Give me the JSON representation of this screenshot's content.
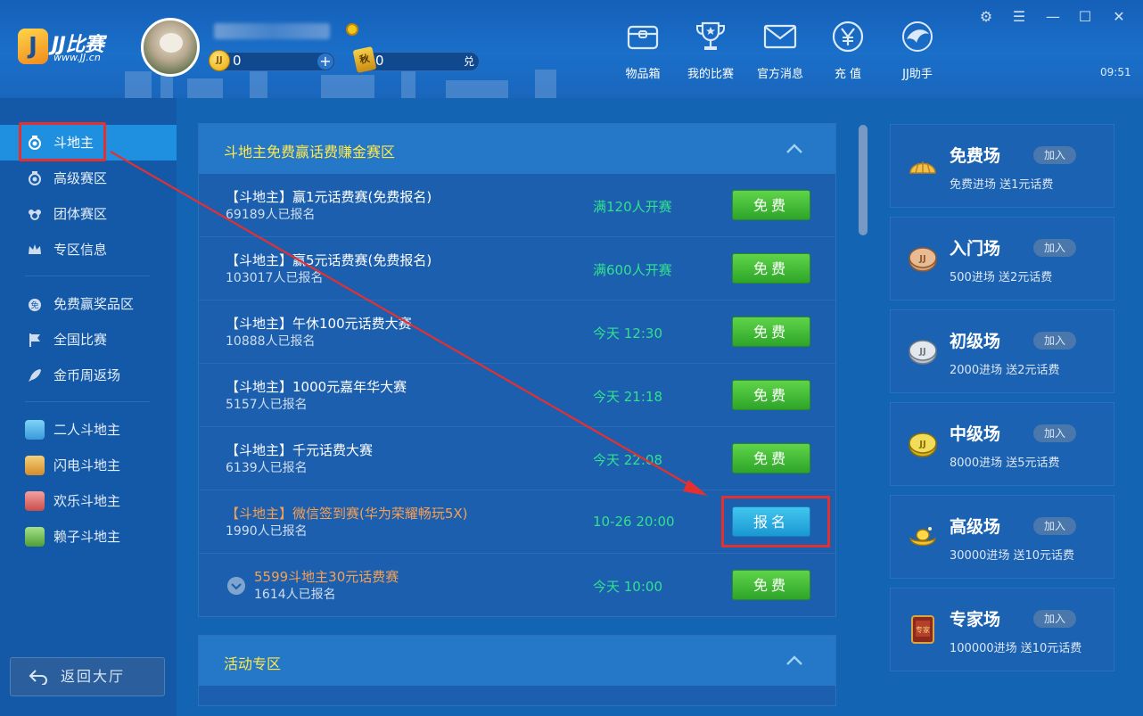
{
  "header": {
    "logo_title": "JJ比赛",
    "logo_url": "www.JJ.cn",
    "gold_value": "0",
    "ticket_value": "0",
    "exchange_label": "兑",
    "plus_label": "+",
    "clock": "09:51",
    "nav": [
      {
        "label": "物品箱",
        "icon": "item-box-icon"
      },
      {
        "label": "我的比赛",
        "icon": "trophy-icon"
      },
      {
        "label": "官方消息",
        "icon": "mail-icon"
      },
      {
        "label": "充 值",
        "icon": "yuan-icon"
      },
      {
        "label": "JJ助手",
        "icon": "dolphin-icon"
      }
    ]
  },
  "sidebar": {
    "groups": [
      [
        {
          "label": "斗地主",
          "icon": "medal-icon",
          "active": true
        },
        {
          "label": "高级赛区",
          "icon": "medal-icon"
        },
        {
          "label": "团体赛区",
          "icon": "team-icon"
        },
        {
          "label": "专区信息",
          "icon": "crown-icon"
        }
      ],
      [
        {
          "label": "免费赢奖品区",
          "icon": "free-medal-icon"
        },
        {
          "label": "全国比赛",
          "icon": "flag-icon"
        },
        {
          "label": "金币周返场",
          "icon": "rocket-icon"
        }
      ],
      [
        {
          "label": "二人斗地主",
          "icon": "player-avatar-icon"
        },
        {
          "label": "闪电斗地主",
          "icon": "player-avatar-icon"
        },
        {
          "label": "欢乐斗地主",
          "icon": "player-avatar-icon"
        },
        {
          "label": "赖子斗地主",
          "icon": "player-avatar-icon"
        }
      ]
    ],
    "back_label": "返回大厅"
  },
  "main": {
    "section1_title": "斗地主免费赢话费赚金赛区",
    "rows": [
      {
        "title": "【斗地主】赢1元话费赛(免费报名)",
        "count": "69189人已报名",
        "time": "满120人开赛",
        "button": "免费",
        "style": "free"
      },
      {
        "title": "【斗地主】赢5元话费赛(免费报名)",
        "count": "103017人已报名",
        "time": "满600人开赛",
        "button": "免费",
        "style": "free"
      },
      {
        "title": "【斗地主】午休100元话费大赛",
        "count": "10888人已报名",
        "time": "今天 12:30",
        "button": "免费",
        "style": "free"
      },
      {
        "title": "【斗地主】1000元嘉年华大赛",
        "count": "5157人已报名",
        "time": "今天 21:18",
        "button": "免费",
        "style": "free"
      },
      {
        "title": "【斗地主】千元话费大赛",
        "count": "6139人已报名",
        "time": "今天 22:08",
        "button": "免费",
        "style": "free"
      },
      {
        "title": "【斗地主】微信签到赛(华为荣耀畅玩5X)",
        "count": "1990人已报名",
        "time": "10-26 20:00",
        "button": "报名",
        "style": "signup"
      },
      {
        "title": "5599斗地主30元话费赛",
        "count": "1614人已报名",
        "time": "今天 10:00",
        "button": "免费",
        "style": "free"
      }
    ],
    "section2_title": "活动专区"
  },
  "levels": [
    {
      "name": "免费场",
      "join": "加入",
      "desc": "免费进场 送1元话费",
      "icon": "shell-coin-icon"
    },
    {
      "name": "入门场",
      "join": "加入",
      "desc": "500进场 送2元话费",
      "icon": "bronze-coin-icon"
    },
    {
      "name": "初级场",
      "join": "加入",
      "desc": "2000进场 送2元话费",
      "icon": "silver-coin-icon"
    },
    {
      "name": "中级场",
      "join": "加入",
      "desc": "8000进场 送5元话费",
      "icon": "gold-coin-icon"
    },
    {
      "name": "高级场",
      "join": "加入",
      "desc": "30000进场 送10元话费",
      "icon": "gold-ingot-icon"
    },
    {
      "name": "专家场",
      "join": "加入",
      "desc": "100000进场 送10元话费",
      "icon": "expert-badge-icon"
    }
  ],
  "colors": {
    "accent_yellow": "#ffe94d",
    "time_green": "#32e08f",
    "free_green": "#3fbf2f",
    "signup_blue": "#1fa6dd",
    "highlight_red": "#e53030"
  }
}
